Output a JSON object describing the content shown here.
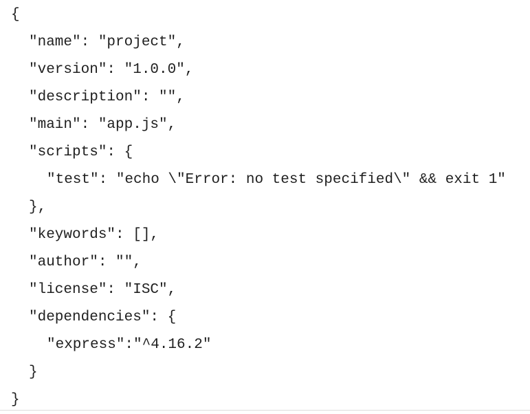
{
  "code": {
    "lines": [
      "{",
      "\"name\": \"project\",",
      "\"version\": \"1.0.0\",",
      "\"description\": \"\",",
      "\"main\": \"app.js\",",
      "\"scripts\": {",
      "\"test\": \"echo \\\"Error: no test specified\\\" && exit 1\"",
      "},",
      "\"keywords\": [],",
      "\"author\": \"\",",
      "\"license\": \"ISC\",",
      "\"dependencies\": {",
      "\"express\":\"^4.16.2\"",
      "}",
      "}"
    ]
  }
}
